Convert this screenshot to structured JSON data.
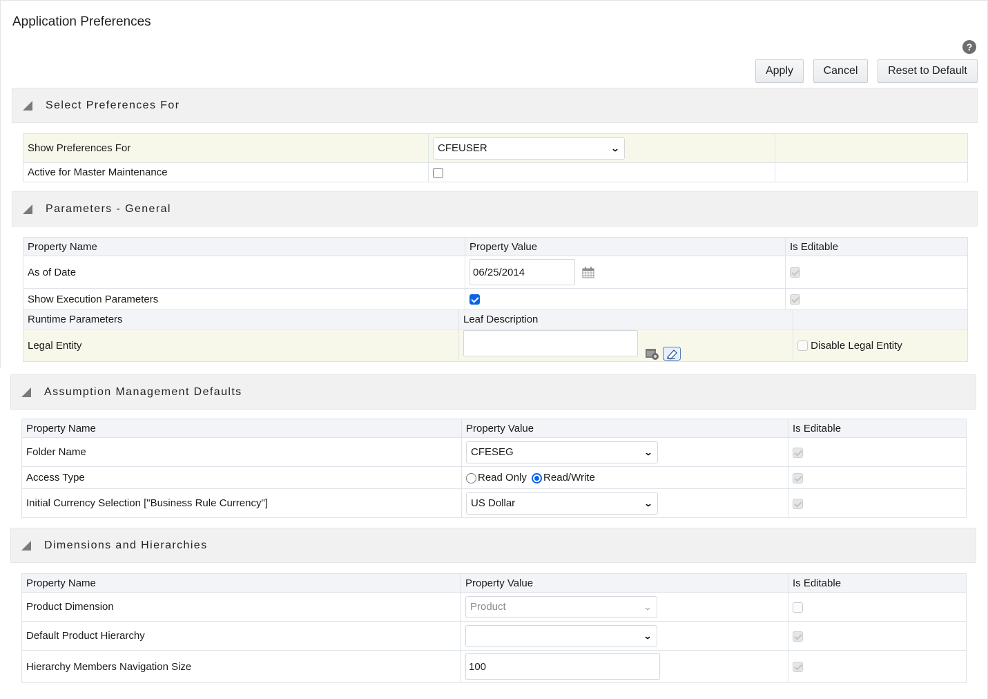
{
  "page": {
    "title": "Application Preferences",
    "help_icon": "help-icon",
    "help_glyph": "?"
  },
  "toolbar": {
    "apply_label": "Apply",
    "cancel_label": "Cancel",
    "reset_label": "Reset to Default"
  },
  "sections": {
    "select_prefs": {
      "title": "Select Preferences For",
      "rows": [
        {
          "label": "Show Preferences For",
          "value": "CFEUSER"
        },
        {
          "label": "Active for Master Maintenance",
          "checked": false
        }
      ]
    },
    "params_general": {
      "title": "Parameters - General",
      "headers": [
        "Property Name",
        "Property Value",
        "Is Editable"
      ],
      "rows": [
        {
          "label": "As of Date",
          "value": "06/25/2014",
          "editable": true
        },
        {
          "label": "Show Execution Parameters",
          "checked": true,
          "editable": true
        }
      ],
      "runtime_headers": [
        "Runtime Parameters",
        "Leaf Description",
        ""
      ],
      "runtime_rows": [
        {
          "label": "Legal Entity",
          "value": "",
          "disable_label": "Disable Legal Entity",
          "disable_checked": false
        }
      ]
    },
    "assumption_mgmt": {
      "title": "Assumption Management Defaults",
      "headers": [
        "Property Name",
        "Property Value",
        "Is Editable"
      ],
      "rows": [
        {
          "label": "Folder Name",
          "value": "CFESEG",
          "editable": true
        },
        {
          "label": "Access Type",
          "options": [
            "Read Only",
            "Read/Write"
          ],
          "selected": "Read/Write",
          "editable": true
        },
        {
          "label": "Initial Currency Selection [\"Business Rule Currency\"]",
          "value": "US Dollar",
          "editable": true
        }
      ]
    },
    "dimensions": {
      "title": "Dimensions and Hierarchies",
      "headers": [
        "Property Name",
        "Property Value",
        "Is Editable"
      ],
      "rows": [
        {
          "label": "Product Dimension",
          "value": "Product",
          "disabled": true,
          "editable": false
        },
        {
          "label": "Default Product Hierarchy",
          "value": "",
          "editable": true
        },
        {
          "label": "Hierarchy Members Navigation Size",
          "value": "100",
          "editable": true
        }
      ]
    }
  },
  "glyphs": {
    "chevron": "⌄"
  }
}
